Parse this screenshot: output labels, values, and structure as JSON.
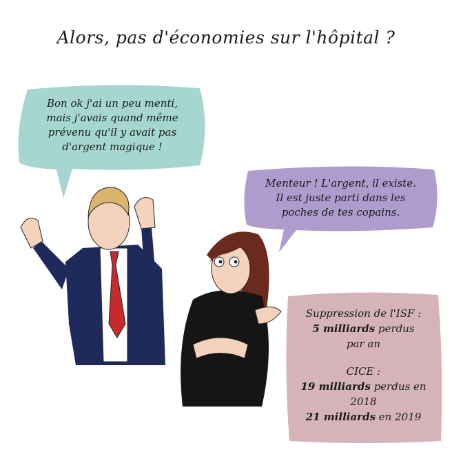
{
  "title": "Alors, pas d'économies sur l'hôpital ?",
  "man_bubble": [
    "Bon ok j'ai un peu menti,",
    "mais j'avais quand même",
    "prévenu qu'il y avait pas",
    "d'argent magique !"
  ],
  "woman_bubble": [
    "Menteur ! L'argent, il existe.",
    "Il est juste parti dans les",
    "poches de tes copains."
  ],
  "facts": {
    "isf_label": "Suppression de l'ISF :",
    "isf_amount": "5 milliards",
    "isf_rest1": " perdus",
    "isf_rest2": "par an",
    "cice_label": "CICE :",
    "cice_amount1": "19 milliards",
    "cice_rest1": " perdus en",
    "cice_year1": "2018",
    "cice_amount2": "21 milliards",
    "cice_rest2": " en 2019"
  },
  "colors": {
    "teal": "#a6d6d0",
    "purple": "#ad9ccd",
    "pink": "#d5b3b9",
    "suit": "#1f2a5c",
    "tie": "#c62a2a",
    "hair": "#6b2a1e"
  }
}
